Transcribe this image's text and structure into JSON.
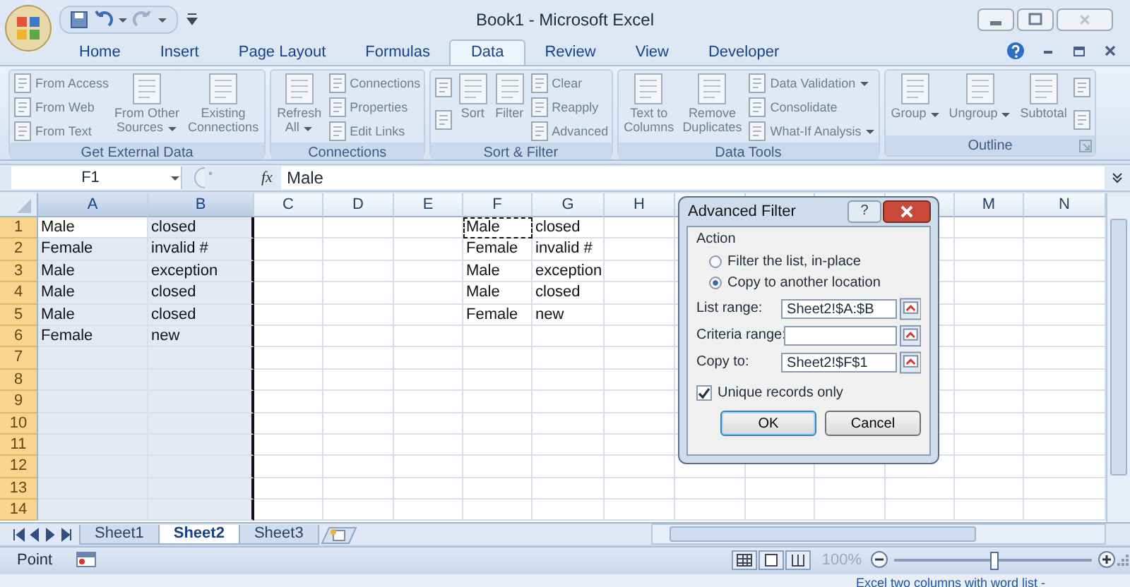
{
  "window": {
    "title": "Book1 - Microsoft Excel"
  },
  "tabs": [
    {
      "label": "Home",
      "selected": false
    },
    {
      "label": "Insert",
      "selected": false
    },
    {
      "label": "Page Layout",
      "selected": false
    },
    {
      "label": "Formulas",
      "selected": false
    },
    {
      "label": "Data",
      "selected": true
    },
    {
      "label": "Review",
      "selected": false
    },
    {
      "label": "View",
      "selected": false
    },
    {
      "label": "Developer",
      "selected": false
    }
  ],
  "ribbon": [
    {
      "name": "Get External Data",
      "items": [
        {
          "kind": "stack",
          "entries": [
            {
              "label": "From Access"
            },
            {
              "label": "From Web"
            },
            {
              "label": "From Text"
            }
          ]
        },
        {
          "kind": "large",
          "lines": [
            "From Other",
            "Sources"
          ],
          "dropdown": true
        },
        {
          "kind": "large",
          "lines": [
            "Existing",
            "Connections"
          ]
        }
      ]
    },
    {
      "name": "Connections",
      "items": [
        {
          "kind": "large",
          "lines": [
            "Refresh",
            "All"
          ],
          "dropdown": true
        },
        {
          "kind": "stack",
          "entries": [
            {
              "label": "Connections"
            },
            {
              "label": "Properties"
            },
            {
              "label": "Edit Links"
            }
          ]
        }
      ]
    },
    {
      "name": "Sort & Filter",
      "items": [
        {
          "kind": "icon_stack"
        },
        {
          "kind": "large",
          "lines": [
            "Sort"
          ]
        },
        {
          "kind": "large",
          "lines": [
            "Filter"
          ]
        },
        {
          "kind": "stack",
          "entries": [
            {
              "label": "Clear"
            },
            {
              "label": "Reapply"
            },
            {
              "label": "Advanced"
            }
          ]
        }
      ]
    },
    {
      "name": "Data Tools",
      "items": [
        {
          "kind": "large",
          "lines": [
            "Text to",
            "Columns"
          ]
        },
        {
          "kind": "large",
          "lines": [
            "Remove",
            "Duplicates"
          ]
        },
        {
          "kind": "stack",
          "entries": [
            {
              "label": "Data Validation",
              "dropdown": true
            },
            {
              "label": "Consolidate"
            },
            {
              "label": "What-If Analysis",
              "dropdown": true
            }
          ]
        }
      ]
    },
    {
      "name": "Outline",
      "items": [
        {
          "kind": "large",
          "lines": [
            "Group"
          ],
          "dropdown": true
        },
        {
          "kind": "large",
          "lines": [
            "Ungroup"
          ],
          "dropdown": true
        },
        {
          "kind": "large",
          "lines": [
            "Subtotal"
          ]
        },
        {
          "kind": "icon_stack"
        }
      ]
    }
  ],
  "formula_bar": {
    "name_box": "F1",
    "function_label": "fx",
    "value": "Male"
  },
  "columns": [
    {
      "label": "A",
      "selected": true
    },
    {
      "label": "B",
      "selected": true
    },
    {
      "label": "C",
      "selected": false
    },
    {
      "label": "D",
      "selected": false
    },
    {
      "label": "E",
      "selected": false
    },
    {
      "label": "F",
      "selected": false
    },
    {
      "label": "G",
      "selected": false
    },
    {
      "label": "H",
      "selected": false
    }
  ],
  "right_columns": [
    {
      "label": "M",
      "selected": false
    },
    {
      "label": "N",
      "selected": false
    }
  ],
  "rows": [
    {
      "number": "1",
      "selected": true,
      "source": [
        "Male",
        "closed"
      ],
      "copy": [
        "Male",
        "closed"
      ],
      "copy_marked": true
    },
    {
      "number": "2",
      "selected": true,
      "source": [
        "Female",
        "invalid #"
      ],
      "copy": [
        "Female",
        "invalid #"
      ],
      "copy_marked": false
    },
    {
      "number": "3",
      "selected": true,
      "source": [
        "Male",
        "exception"
      ],
      "copy": [
        "Male",
        "exception"
      ],
      "copy_marked": false
    },
    {
      "number": "4",
      "selected": true,
      "source": [
        "Male",
        "closed"
      ],
      "copy": [
        "Male",
        "closed"
      ],
      "copy_marked": false
    },
    {
      "number": "5",
      "selected": true,
      "source": [
        "Male",
        "closed"
      ],
      "copy": [
        "Female",
        "new"
      ],
      "copy_marked": false
    },
    {
      "number": "6",
      "selected": true,
      "source": [
        "Female",
        "new"
      ],
      "copy_marked": false
    },
    {
      "number": "7",
      "selected": true,
      "copy_marked": false
    },
    {
      "number": "8",
      "selected": true,
      "copy_marked": false
    },
    {
      "number": "9",
      "selected": true,
      "copy_marked": false
    },
    {
      "number": "10",
      "selected": true,
      "copy_marked": false
    },
    {
      "number": "11",
      "selected": true,
      "copy_marked": false
    },
    {
      "number": "12",
      "selected": true,
      "copy_marked": false
    },
    {
      "number": "13",
      "selected": true,
      "copy_marked": false
    },
    {
      "number": "14",
      "selected": true,
      "copy_marked": false
    }
  ],
  "dialog": {
    "title": "Advanced Filter",
    "help": "?",
    "section": "Action",
    "radios": [
      {
        "label": "Filter the list, in-place",
        "selected": false
      },
      {
        "label": "Copy to another location",
        "selected": true
      }
    ],
    "fields": [
      {
        "label": "List range:",
        "value": "Sheet2!$A:$B"
      },
      {
        "label": "Criteria range:"
      },
      {
        "label": "Copy to:",
        "value": "Sheet2!$F$1"
      }
    ],
    "checkbox": {
      "label": "Unique records only",
      "checked": true
    },
    "buttons": [
      {
        "label": "OK",
        "default": true
      },
      {
        "label": "Cancel",
        "default": false
      }
    ]
  },
  "sheets": [
    {
      "label": "Sheet1",
      "selected": false
    },
    {
      "label": "Sheet2",
      "selected": true
    },
    {
      "label": "Sheet3",
      "selected": false
    }
  ],
  "status_bar": {
    "mode": "Point",
    "zoom": "100%",
    "zoom_slider": {
      "level": 0.5
    }
  },
  "background_link": "Excel two columns with word list -"
}
